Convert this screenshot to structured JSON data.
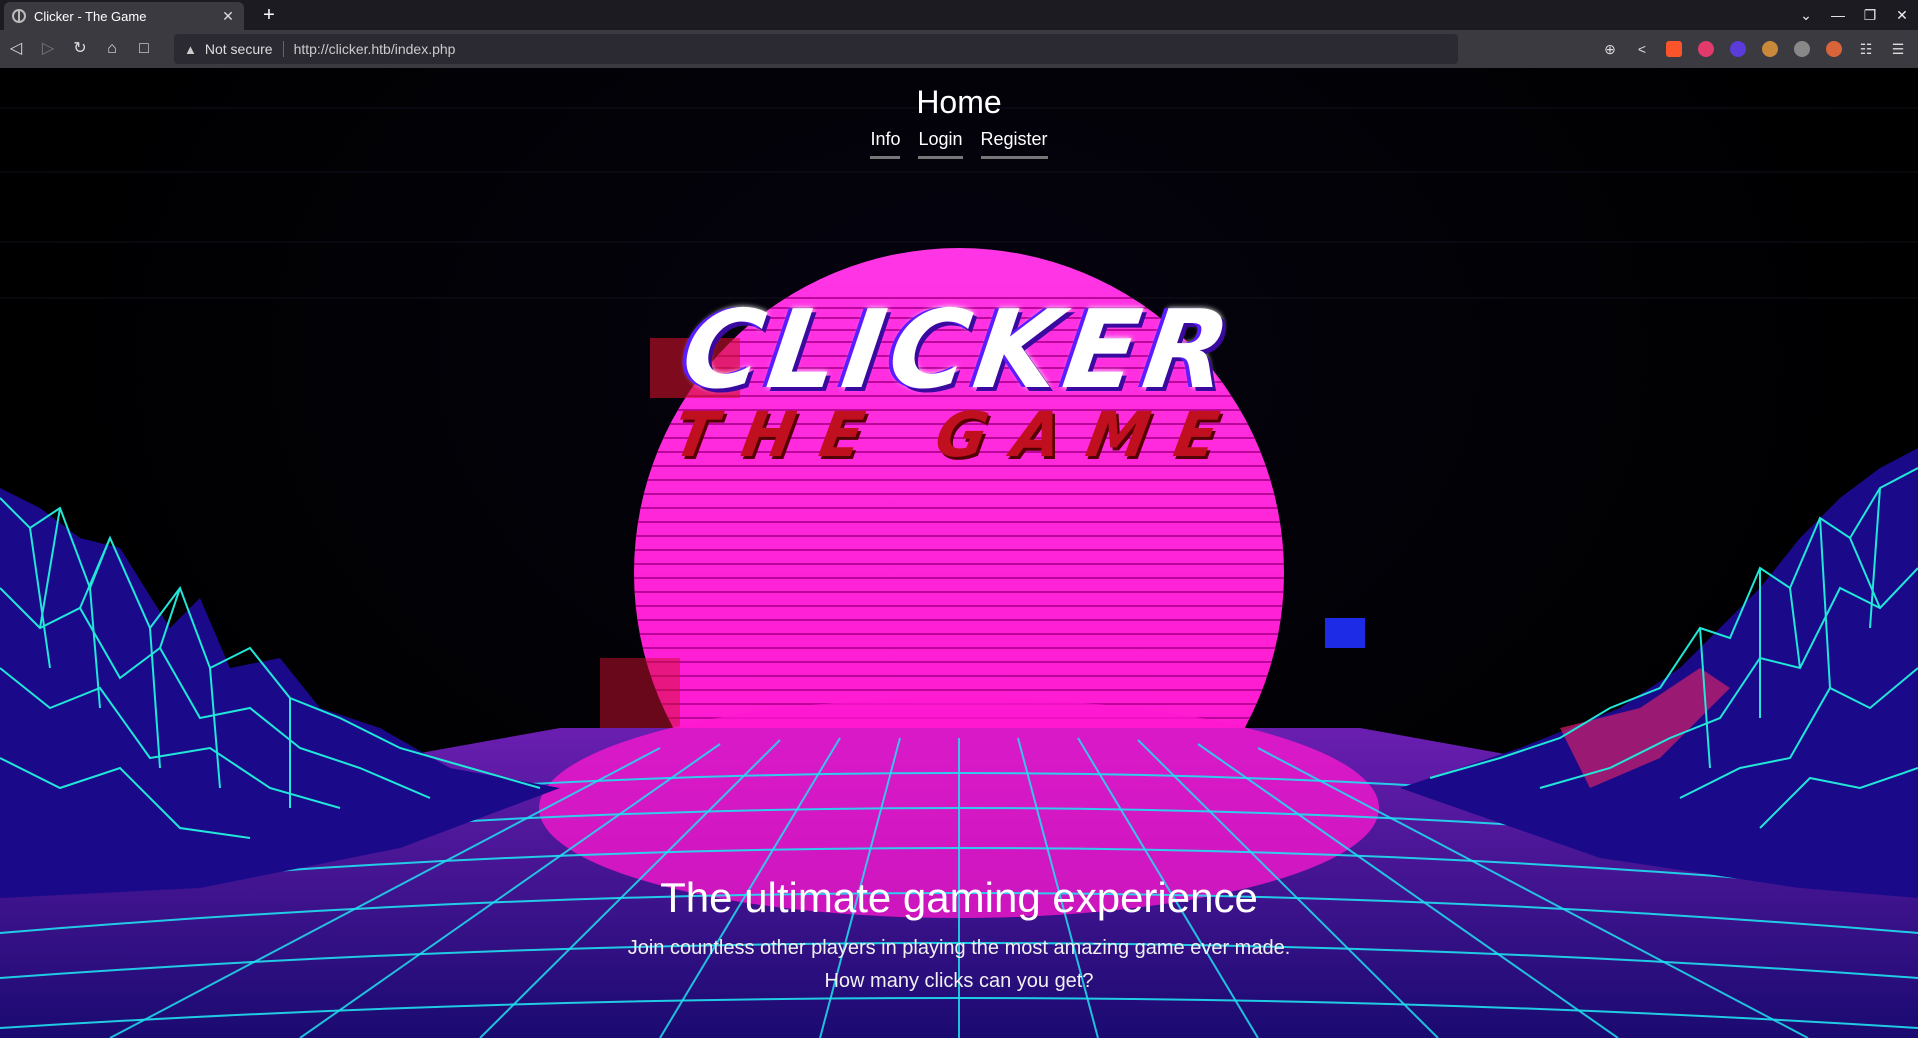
{
  "browser": {
    "tab_title": "Clicker - The Game",
    "tab_close": "✕",
    "new_tab": "+",
    "security_label": "Not secure",
    "url": "http://clicker.htb/index.php",
    "window_controls": [
      "⌄",
      "—",
      "❐",
      "✕"
    ]
  },
  "site": {
    "title": "Home",
    "nav": [
      {
        "label": "Info"
      },
      {
        "label": "Login"
      },
      {
        "label": "Register"
      }
    ],
    "logo": {
      "main": "CLICKER",
      "sub": "THE GAME"
    },
    "hero": {
      "heading": "The ultimate gaming experience",
      "text": "Join countless other players in playing the most amazing game ever made. How many clicks can you get?"
    }
  },
  "colors": {
    "sun": "#ff1fd8",
    "grid": "#20e0f0",
    "grid_dark": "#2a22c8",
    "logo_sub": "#c01020"
  }
}
